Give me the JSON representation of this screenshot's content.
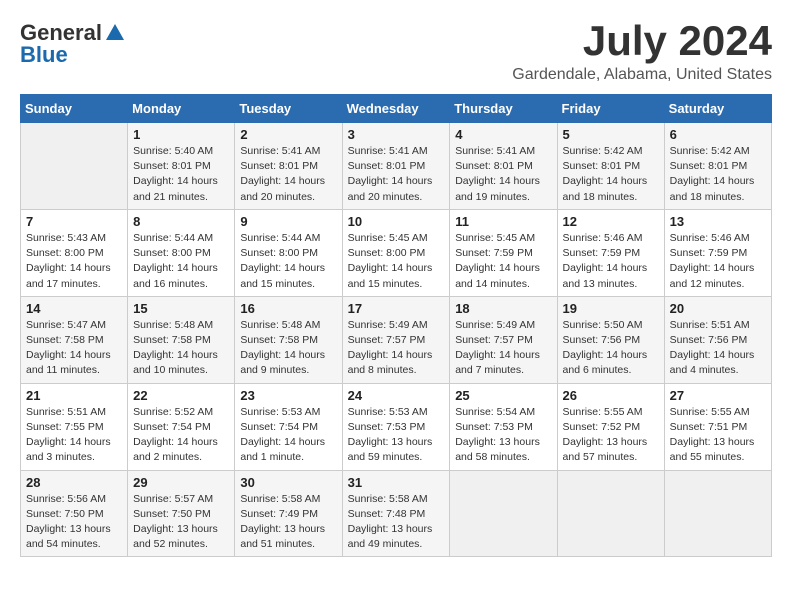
{
  "header": {
    "logo_general": "General",
    "logo_blue": "Blue",
    "month_year": "July 2024",
    "location": "Gardendale, Alabama, United States"
  },
  "days_of_week": [
    "Sunday",
    "Monday",
    "Tuesday",
    "Wednesday",
    "Thursday",
    "Friday",
    "Saturday"
  ],
  "weeks": [
    [
      {
        "num": "",
        "sunrise": "",
        "sunset": "",
        "daylight": "",
        "empty": true
      },
      {
        "num": "1",
        "sunrise": "Sunrise: 5:40 AM",
        "sunset": "Sunset: 8:01 PM",
        "daylight": "Daylight: 14 hours and 21 minutes."
      },
      {
        "num": "2",
        "sunrise": "Sunrise: 5:41 AM",
        "sunset": "Sunset: 8:01 PM",
        "daylight": "Daylight: 14 hours and 20 minutes."
      },
      {
        "num": "3",
        "sunrise": "Sunrise: 5:41 AM",
        "sunset": "Sunset: 8:01 PM",
        "daylight": "Daylight: 14 hours and 20 minutes."
      },
      {
        "num": "4",
        "sunrise": "Sunrise: 5:41 AM",
        "sunset": "Sunset: 8:01 PM",
        "daylight": "Daylight: 14 hours and 19 minutes."
      },
      {
        "num": "5",
        "sunrise": "Sunrise: 5:42 AM",
        "sunset": "Sunset: 8:01 PM",
        "daylight": "Daylight: 14 hours and 18 minutes."
      },
      {
        "num": "6",
        "sunrise": "Sunrise: 5:42 AM",
        "sunset": "Sunset: 8:01 PM",
        "daylight": "Daylight: 14 hours and 18 minutes."
      }
    ],
    [
      {
        "num": "7",
        "sunrise": "Sunrise: 5:43 AM",
        "sunset": "Sunset: 8:00 PM",
        "daylight": "Daylight: 14 hours and 17 minutes."
      },
      {
        "num": "8",
        "sunrise": "Sunrise: 5:44 AM",
        "sunset": "Sunset: 8:00 PM",
        "daylight": "Daylight: 14 hours and 16 minutes."
      },
      {
        "num": "9",
        "sunrise": "Sunrise: 5:44 AM",
        "sunset": "Sunset: 8:00 PM",
        "daylight": "Daylight: 14 hours and 15 minutes."
      },
      {
        "num": "10",
        "sunrise": "Sunrise: 5:45 AM",
        "sunset": "Sunset: 8:00 PM",
        "daylight": "Daylight: 14 hours and 15 minutes."
      },
      {
        "num": "11",
        "sunrise": "Sunrise: 5:45 AM",
        "sunset": "Sunset: 7:59 PM",
        "daylight": "Daylight: 14 hours and 14 minutes."
      },
      {
        "num": "12",
        "sunrise": "Sunrise: 5:46 AM",
        "sunset": "Sunset: 7:59 PM",
        "daylight": "Daylight: 14 hours and 13 minutes."
      },
      {
        "num": "13",
        "sunrise": "Sunrise: 5:46 AM",
        "sunset": "Sunset: 7:59 PM",
        "daylight": "Daylight: 14 hours and 12 minutes."
      }
    ],
    [
      {
        "num": "14",
        "sunrise": "Sunrise: 5:47 AM",
        "sunset": "Sunset: 7:58 PM",
        "daylight": "Daylight: 14 hours and 11 minutes."
      },
      {
        "num": "15",
        "sunrise": "Sunrise: 5:48 AM",
        "sunset": "Sunset: 7:58 PM",
        "daylight": "Daylight: 14 hours and 10 minutes."
      },
      {
        "num": "16",
        "sunrise": "Sunrise: 5:48 AM",
        "sunset": "Sunset: 7:58 PM",
        "daylight": "Daylight: 14 hours and 9 minutes."
      },
      {
        "num": "17",
        "sunrise": "Sunrise: 5:49 AM",
        "sunset": "Sunset: 7:57 PM",
        "daylight": "Daylight: 14 hours and 8 minutes."
      },
      {
        "num": "18",
        "sunrise": "Sunrise: 5:49 AM",
        "sunset": "Sunset: 7:57 PM",
        "daylight": "Daylight: 14 hours and 7 minutes."
      },
      {
        "num": "19",
        "sunrise": "Sunrise: 5:50 AM",
        "sunset": "Sunset: 7:56 PM",
        "daylight": "Daylight: 14 hours and 6 minutes."
      },
      {
        "num": "20",
        "sunrise": "Sunrise: 5:51 AM",
        "sunset": "Sunset: 7:56 PM",
        "daylight": "Daylight: 14 hours and 4 minutes."
      }
    ],
    [
      {
        "num": "21",
        "sunrise": "Sunrise: 5:51 AM",
        "sunset": "Sunset: 7:55 PM",
        "daylight": "Daylight: 14 hours and 3 minutes."
      },
      {
        "num": "22",
        "sunrise": "Sunrise: 5:52 AM",
        "sunset": "Sunset: 7:54 PM",
        "daylight": "Daylight: 14 hours and 2 minutes."
      },
      {
        "num": "23",
        "sunrise": "Sunrise: 5:53 AM",
        "sunset": "Sunset: 7:54 PM",
        "daylight": "Daylight: 14 hours and 1 minute."
      },
      {
        "num": "24",
        "sunrise": "Sunrise: 5:53 AM",
        "sunset": "Sunset: 7:53 PM",
        "daylight": "Daylight: 13 hours and 59 minutes."
      },
      {
        "num": "25",
        "sunrise": "Sunrise: 5:54 AM",
        "sunset": "Sunset: 7:53 PM",
        "daylight": "Daylight: 13 hours and 58 minutes."
      },
      {
        "num": "26",
        "sunrise": "Sunrise: 5:55 AM",
        "sunset": "Sunset: 7:52 PM",
        "daylight": "Daylight: 13 hours and 57 minutes."
      },
      {
        "num": "27",
        "sunrise": "Sunrise: 5:55 AM",
        "sunset": "Sunset: 7:51 PM",
        "daylight": "Daylight: 13 hours and 55 minutes."
      }
    ],
    [
      {
        "num": "28",
        "sunrise": "Sunrise: 5:56 AM",
        "sunset": "Sunset: 7:50 PM",
        "daylight": "Daylight: 13 hours and 54 minutes."
      },
      {
        "num": "29",
        "sunrise": "Sunrise: 5:57 AM",
        "sunset": "Sunset: 7:50 PM",
        "daylight": "Daylight: 13 hours and 52 minutes."
      },
      {
        "num": "30",
        "sunrise": "Sunrise: 5:58 AM",
        "sunset": "Sunset: 7:49 PM",
        "daylight": "Daylight: 13 hours and 51 minutes."
      },
      {
        "num": "31",
        "sunrise": "Sunrise: 5:58 AM",
        "sunset": "Sunset: 7:48 PM",
        "daylight": "Daylight: 13 hours and 49 minutes."
      },
      {
        "num": "",
        "sunrise": "",
        "sunset": "",
        "daylight": "",
        "empty": true
      },
      {
        "num": "",
        "sunrise": "",
        "sunset": "",
        "daylight": "",
        "empty": true
      },
      {
        "num": "",
        "sunrise": "",
        "sunset": "",
        "daylight": "",
        "empty": true
      }
    ]
  ]
}
